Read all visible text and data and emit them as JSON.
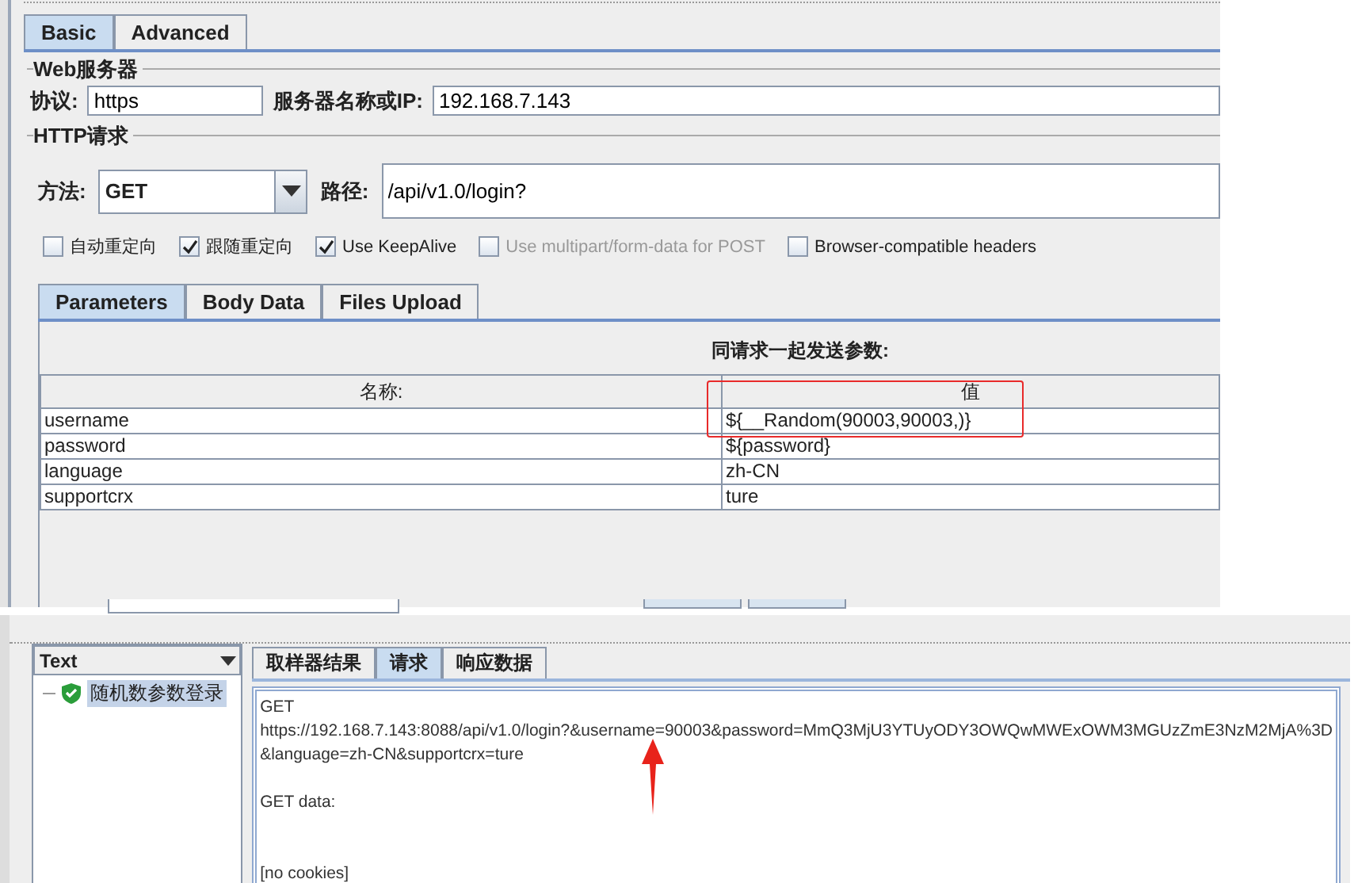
{
  "top_tabs": [
    {
      "label": "Basic",
      "selected": true
    },
    {
      "label": "Advanced",
      "selected": false
    }
  ],
  "web_server": {
    "title": "Web服务器",
    "protocol_label": "协议:",
    "protocol": "https",
    "server_label": "服务器名称或IP:",
    "server": "192.168.7.143"
  },
  "http_request": {
    "title": "HTTP请求",
    "method_label": "方法:",
    "method": "GET",
    "path_label": "路径:",
    "path": "/api/v1.0/login?"
  },
  "options": [
    {
      "label": "自动重定向",
      "checked": false,
      "disabled": false
    },
    {
      "label": "跟随重定向",
      "checked": true,
      "disabled": false
    },
    {
      "label": "Use KeepAlive",
      "checked": true,
      "disabled": false
    },
    {
      "label": "Use multipart/form-data for POST",
      "checked": false,
      "disabled": true
    },
    {
      "label": "Browser-compatible headers",
      "checked": false,
      "disabled": false
    }
  ],
  "param_tabs": [
    {
      "label": "Parameters",
      "selected": true
    },
    {
      "label": "Body Data",
      "selected": false
    },
    {
      "label": "Files Upload",
      "selected": false
    }
  ],
  "params": {
    "heading": "同请求一起发送参数:",
    "columns": [
      "名称:",
      "值"
    ],
    "rows": [
      {
        "name": "username",
        "value": "${__Random(90003,90003,)}"
      },
      {
        "name": "password",
        "value": "${password}"
      },
      {
        "name": "language",
        "value": "zh-CN"
      },
      {
        "name": "supportcrx",
        "value": "ture"
      }
    ]
  },
  "results": {
    "view_mode": "Text",
    "tree": [
      {
        "label": "随机数参数登录",
        "selected": true
      }
    ],
    "tabs": [
      {
        "label": "取样器结果",
        "selected": false
      },
      {
        "label": "请求",
        "selected": true
      },
      {
        "label": "响应数据",
        "selected": false
      }
    ],
    "blocks": [
      [
        "GET",
        "https://192.168.7.143:8088/api/v1.0/login?&username=90003&password=MmQ3MjU3YTUyODY3OWQwMWExOWM3MGUzZmE3NzM2MjA%3D",
        "&language=zh-CN&supportcrx=ture"
      ],
      [
        "GET data:"
      ],
      [
        "[no cookies]"
      ]
    ]
  }
}
